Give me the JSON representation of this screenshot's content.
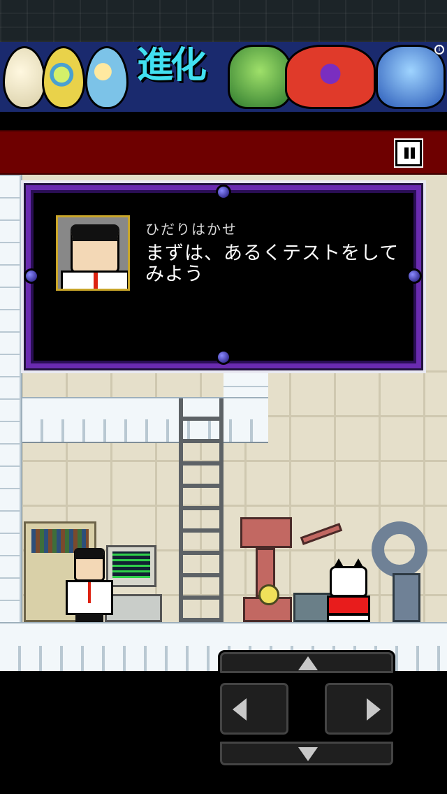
{
  "ad_banner": {
    "headline": "進化",
    "icons": [
      "egg-white-icon",
      "egg-green-icon",
      "egg-blue-icon",
      "dragon-green-icon",
      "dragon-red-icon",
      "dragon-blue-icon",
      "info-icon"
    ]
  },
  "header": {
    "pause_icon": "pause-icon"
  },
  "dialog": {
    "speaker_name": "ひだりはかせ",
    "message": "まずは、あるくテストをしてみよう",
    "portrait_icon": "scientist-portrait-icon"
  },
  "scene": {
    "sprites": [
      "scientist-sprite",
      "cat-robot-sprite",
      "ladder",
      "bookshelf",
      "computer",
      "robot-machine",
      "arm-machine"
    ]
  },
  "controls": {
    "dpad": [
      "up-arrow-icon",
      "left-arrow-icon",
      "right-arrow-icon",
      "down-arrow-icon"
    ]
  },
  "colors": {
    "header_bar": "#6e0000",
    "dialog_frame": "#6a2bb0",
    "wall": "#e3ddc8",
    "floor": "#f2f7fa"
  }
}
